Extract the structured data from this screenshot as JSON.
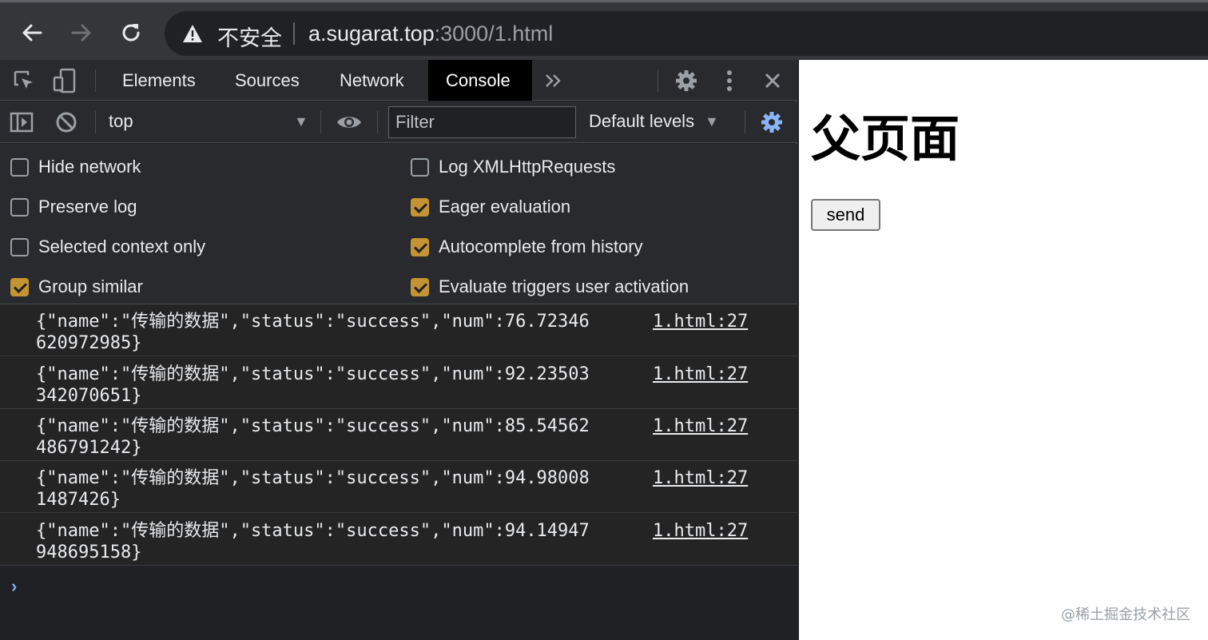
{
  "browser": {
    "security_label": "不安全",
    "url_host": "a.sugarat.top",
    "url_rest": ":3000/1.html"
  },
  "devtools": {
    "tabs": [
      "Elements",
      "Sources",
      "Network",
      "Console"
    ],
    "active_tab": "Console",
    "toolbar": {
      "context": "top",
      "filter_placeholder": "Filter",
      "levels": "Default levels"
    },
    "settings": {
      "left": [
        {
          "label": "Hide network",
          "checked": false
        },
        {
          "label": "Preserve log",
          "checked": false
        },
        {
          "label": "Selected context only",
          "checked": false
        },
        {
          "label": "Group similar",
          "checked": true
        }
      ],
      "right": [
        {
          "label": "Log XMLHttpRequests",
          "checked": false
        },
        {
          "label": "Eager evaluation",
          "checked": true
        },
        {
          "label": "Autocomplete from history",
          "checked": true
        },
        {
          "label": "Evaluate triggers user activation",
          "checked": true
        }
      ]
    },
    "messages": [
      {
        "text": "{\"name\":\"传输的数据\",\"status\":\"success\",\"num\":76.72346620972985}",
        "source": "1.html:27"
      },
      {
        "text": "{\"name\":\"传输的数据\",\"status\":\"success\",\"num\":92.23503342070651}",
        "source": "1.html:27"
      },
      {
        "text": "{\"name\":\"传输的数据\",\"status\":\"success\",\"num\":85.54562486791242}",
        "source": "1.html:27"
      },
      {
        "text": "{\"name\":\"传输的数据\",\"status\":\"success\",\"num\":94.980081487426}",
        "source": "1.html:27"
      },
      {
        "text": "{\"name\":\"传输的数据\",\"status\":\"success\",\"num\":94.14947948695158}",
        "source": "1.html:27"
      }
    ],
    "prompt": "›"
  },
  "page": {
    "title": "父页面",
    "button": "send",
    "watermark": "@稀土掘金技术社区"
  },
  "colors": {
    "accent": "#8ab4f8",
    "checkbox": "#c39334"
  },
  "icons": [
    "back-arrow-icon",
    "forward-arrow-icon",
    "reload-icon",
    "warning-icon",
    "inspect-icon",
    "device-toggle-icon",
    "more-tabs-icon",
    "gear-icon",
    "kebab-menu-icon",
    "close-icon",
    "sidebar-icon",
    "clear-icon",
    "eye-icon",
    "settings-gear-icon"
  ]
}
